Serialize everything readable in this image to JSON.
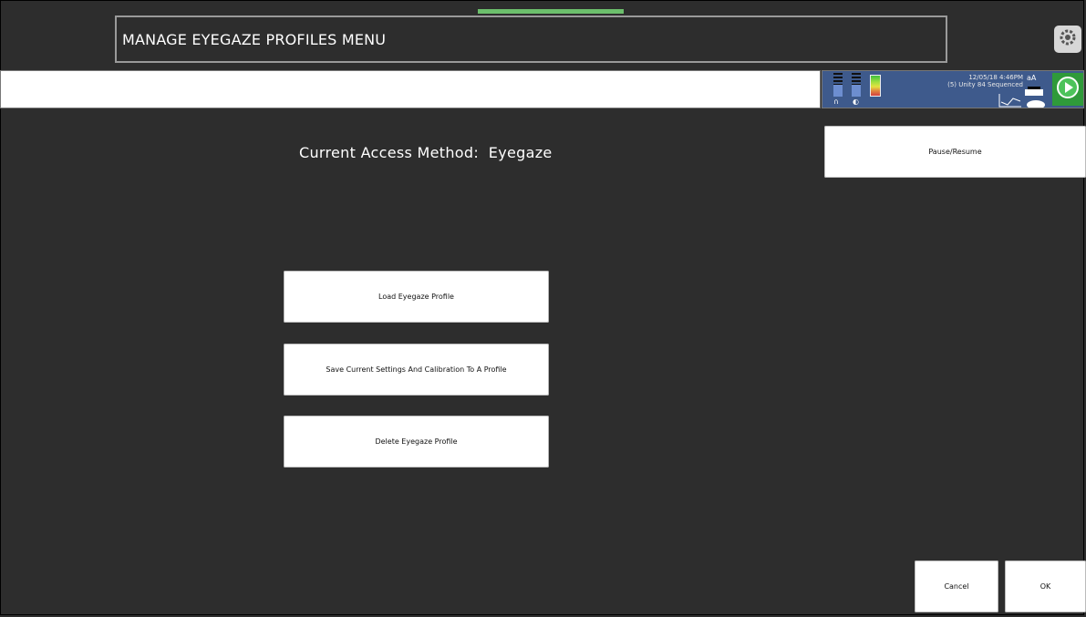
{
  "header": {
    "title": "MANAGE EYEGAZE PROFILES MENU",
    "settings_icon": "gear-icon"
  },
  "status": {
    "datetime": "12/05/18 4:46PM",
    "vocabulary": "(5) Unity 84 Sequenced",
    "font_size_glyph": "aA",
    "play_icon": "play-icon"
  },
  "main": {
    "access_method_label": "Current Access Method:  Eyegaze"
  },
  "buttons": {
    "pause_resume": "Pause/Resume",
    "load_profile": "Load Eyegaze Profile",
    "save_profile": "Save Current Settings And Calibration To A Profile",
    "delete_profile": "Delete Eyegaze Profile",
    "cancel": "Cancel",
    "ok": "OK"
  },
  "colors": {
    "background": "#2d2d2d",
    "status_panel": "#3e5a8c",
    "accent_green": "#2f9a3a"
  }
}
